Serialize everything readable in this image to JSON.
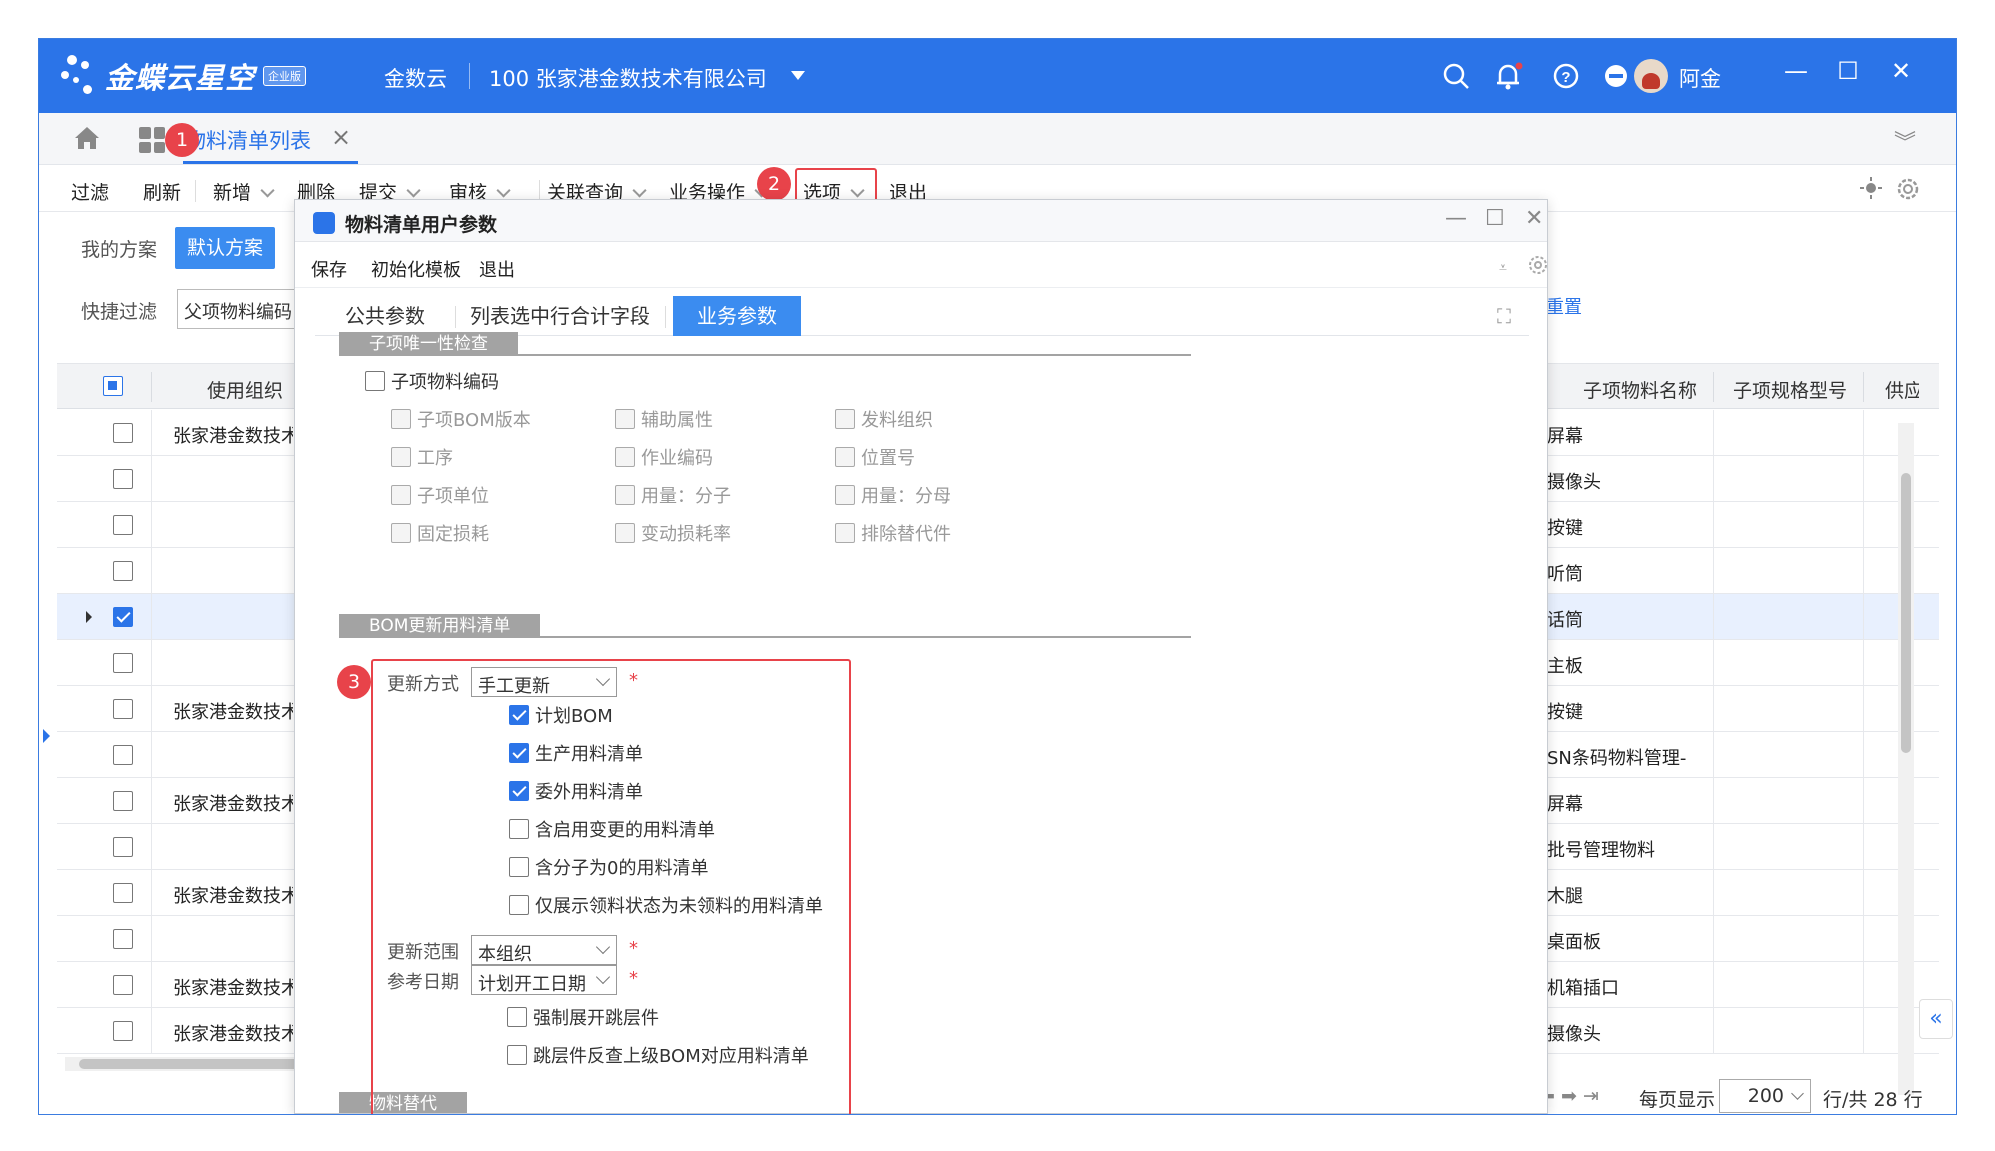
{
  "titlebar": {
    "logo_text": "金蝶云星空",
    "logo_badge": "企业版",
    "app": "金数云",
    "company": "100  张家港金数技术有限公司",
    "user": "阿金"
  },
  "tabs": {
    "active_label": "物料清单列表",
    "close": "×"
  },
  "badges": {
    "one": "1",
    "two": "2",
    "three": "3"
  },
  "toolbar": {
    "filter": "过滤",
    "refresh": "刷新",
    "add": "新增",
    "delete": "删除",
    "submit": "提交",
    "audit": "审核",
    "related_query": "关联查询",
    "business_ops": "业务操作",
    "options": "选项",
    "exit": "退出"
  },
  "filters": {
    "my_scheme": "我的方案",
    "default_scheme": "默认方案",
    "quick_filter": "快捷过滤",
    "quick_filter_value": "父项物料编码",
    "reset": "重置"
  },
  "grid": {
    "headers": {
      "use_org": "使用组织",
      "child_name": "子项物料名称",
      "child_spec": "子项规格型号",
      "supplier": "供应"
    },
    "rows": [
      {
        "org": "张家港金数技术",
        "child": "屏幕",
        "checked": false
      },
      {
        "org": "",
        "child": "摄像头",
        "checked": false
      },
      {
        "org": "",
        "child": "按键",
        "checked": false
      },
      {
        "org": "",
        "child": "听筒",
        "checked": false
      },
      {
        "org": "",
        "child": "话筒",
        "checked": true
      },
      {
        "org": "",
        "child": "主板",
        "checked": false
      },
      {
        "org": "张家港金数技术",
        "child": "按键",
        "checked": false
      },
      {
        "org": "",
        "child": "SN条码物料管理-",
        "checked": false
      },
      {
        "org": "张家港金数技术",
        "child": "屏幕",
        "checked": false
      },
      {
        "org": "",
        "child": "批号管理物料",
        "checked": false
      },
      {
        "org": "张家港金数技术",
        "child": "木腿",
        "checked": false
      },
      {
        "org": "",
        "child": "桌面板",
        "checked": false
      },
      {
        "org": "张家港金数技术",
        "child": "机箱插口",
        "checked": false
      },
      {
        "org": "张家港金数技术",
        "child": "摄像头",
        "checked": false
      }
    ]
  },
  "pager": {
    "per_page_label": "每页显示",
    "per_page": "200",
    "total": "行/共 28 行"
  },
  "modal": {
    "title": "物料清单用户参数",
    "toolbar": {
      "save": "保存",
      "init_template": "初始化模板",
      "exit": "退出"
    },
    "tabs": [
      "公共参数",
      "列表选中行合计字段",
      "业务参数"
    ],
    "section_uniqueness": {
      "title": "子项唯一性检查",
      "main_option": "子项物料编码",
      "options": [
        [
          "子项BOM版本",
          "辅助属性",
          "发料组织"
        ],
        [
          "工序",
          "作业编码",
          "位置号"
        ],
        [
          "子项单位",
          "用量：分子",
          "用量：分母"
        ],
        [
          "固定损耗",
          "变动损耗率",
          "排除替代件"
        ]
      ]
    },
    "section_bom_update": {
      "title": "BOM更新用料清单",
      "update_method_label": "更新方式",
      "update_method": "手工更新",
      "checkbox_options": [
        {
          "label": "计划BOM",
          "checked": true
        },
        {
          "label": "生产用料清单",
          "checked": true
        },
        {
          "label": "委外用料清单",
          "checked": true
        },
        {
          "label": "含启用变更的用料清单",
          "checked": false
        },
        {
          "label": "含分子为0的用料清单",
          "checked": false
        },
        {
          "label": "仅展示领料状态为未领料的用料清单",
          "checked": false
        }
      ],
      "scope_label": "更新范围",
      "scope": "本组织",
      "ref_date_label": "参考日期",
      "ref_date": "计划开工日期",
      "tail_options": [
        {
          "label": "强制展开跳层件",
          "checked": false
        },
        {
          "label": "跳层件反查上级BOM对应用料清单",
          "checked": false
        }
      ],
      "required_mark": "*"
    },
    "section_substitute": {
      "title": "物料替代"
    }
  },
  "colors": {
    "primary": "#2b74e8",
    "badge": "#e8434a",
    "section": "#a3a3a3"
  }
}
